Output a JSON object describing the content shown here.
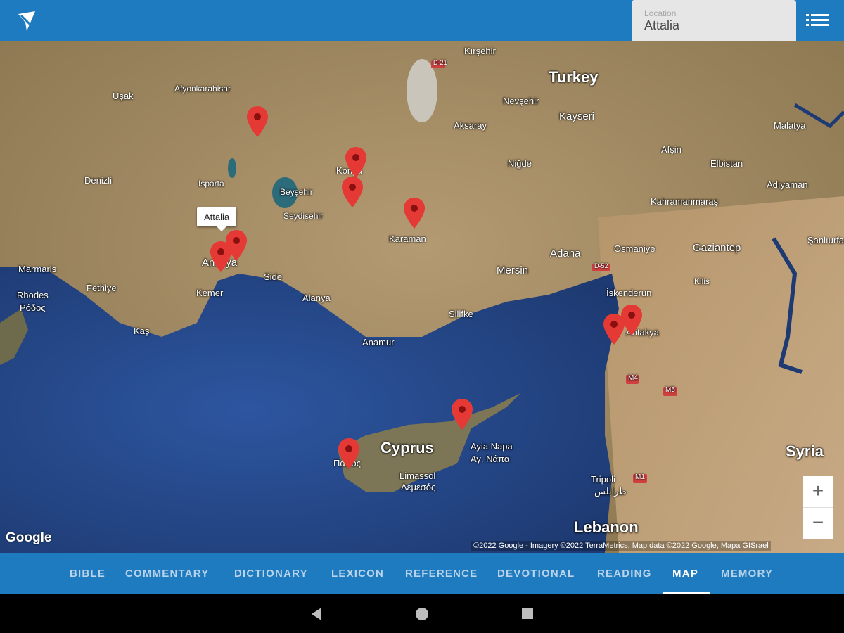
{
  "header": {
    "location_label": "Location",
    "location_value": "Attalia"
  },
  "map": {
    "places": [
      {
        "name": "Kırşehir"
      },
      {
        "name": "Turkey"
      },
      {
        "name": "Uşak"
      },
      {
        "name": "Afyonkarahisar"
      },
      {
        "name": "Nevşehir"
      },
      {
        "name": "Kayseri"
      },
      {
        "name": "Malatya"
      },
      {
        "name": "Aksaray"
      },
      {
        "name": "Afşin"
      },
      {
        "name": "Elbistan"
      },
      {
        "name": "Niğde"
      },
      {
        "name": "Konya"
      },
      {
        "name": "Adıyaman"
      },
      {
        "name": "Denizli"
      },
      {
        "name": "Isparta"
      },
      {
        "name": "Beyşehir"
      },
      {
        "name": "Kahramanmaraş"
      },
      {
        "name": "Seydişehir"
      },
      {
        "name": "Karaman"
      },
      {
        "name": "Şanlıurfa"
      },
      {
        "name": "Adana"
      },
      {
        "name": "Osmaniye"
      },
      {
        "name": "Gaziantep"
      },
      {
        "name": "Antalya"
      },
      {
        "name": "Marmaris"
      },
      {
        "name": "Mersin"
      },
      {
        "name": "Kilis"
      },
      {
        "name": "Rhodes"
      },
      {
        "name": "Ρόδος"
      },
      {
        "name": "Fethiye"
      },
      {
        "name": "Side"
      },
      {
        "name": "Kemer"
      },
      {
        "name": "İskenderun"
      },
      {
        "name": "Alanya"
      },
      {
        "name": "Silifke"
      },
      {
        "name": "Antakya"
      },
      {
        "name": "Kaş"
      },
      {
        "name": "Anamur"
      },
      {
        "name": "Cyprus"
      },
      {
        "name": "Ayia Napa"
      },
      {
        "name": "Αγ. Νάπα"
      },
      {
        "name": "Πάφος"
      },
      {
        "name": "Limassol"
      },
      {
        "name": "Λεμεσός"
      },
      {
        "name": "Syria"
      },
      {
        "name": "Tripoli"
      },
      {
        "name": "طرابلس"
      },
      {
        "name": "Lebanon"
      }
    ],
    "highways": [
      "D-21",
      "D-52",
      "M4",
      "M5",
      "M1"
    ],
    "pins": [
      {
        "name": "pin-1"
      },
      {
        "name": "pin-2"
      },
      {
        "name": "pin-3"
      },
      {
        "name": "pin-4"
      },
      {
        "name": "pin-attalia"
      },
      {
        "name": "pin-perga"
      },
      {
        "name": "pin-5"
      },
      {
        "name": "pin-6"
      },
      {
        "name": "pin-7"
      },
      {
        "name": "pin-8"
      }
    ],
    "callout": "Attalia",
    "google_logo": "Google",
    "attribution": "©2022 Google - Imagery ©2022 TerraMetrics, Map data ©2022 Google, Mapa GISrael",
    "zoom_in": "+",
    "zoom_out": "−"
  },
  "tabs": [
    {
      "label": "BIBLE"
    },
    {
      "label": "COMMENTARY"
    },
    {
      "label": "DICTIONARY"
    },
    {
      "label": "LEXICON"
    },
    {
      "label": "REFERENCE"
    },
    {
      "label": "DEVOTIONAL"
    },
    {
      "label": "READING"
    },
    {
      "label": "MAP",
      "active": true
    },
    {
      "label": "MEMORY"
    }
  ],
  "colors": {
    "brand_blue": "#1f7bbf",
    "pin_red": "#e53935",
    "sea": "#2a4f8f",
    "land": "#a88f68"
  }
}
